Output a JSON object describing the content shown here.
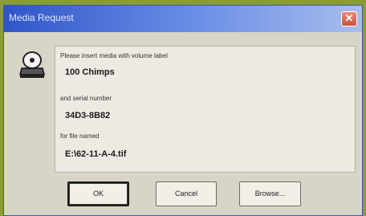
{
  "window": {
    "title": "Media Request"
  },
  "icons": {
    "drive": "disk-drive-icon",
    "close": "close-icon"
  },
  "message": {
    "volume_prompt": "Please insert media with volume label",
    "volume_label": "100 Chimps",
    "serial_prompt": "and serial number",
    "serial_number": "34D3-8B82",
    "file_prompt": "for file named",
    "file_name": "E:\\62-11-A-4.tif"
  },
  "buttons": {
    "ok": "OK",
    "cancel": "Cancel",
    "browse": "Browse..."
  },
  "colors": {
    "titlebar_start": "#2f56c9",
    "dialog_bg": "#d8d4c7",
    "close_button": "#c9523e"
  }
}
